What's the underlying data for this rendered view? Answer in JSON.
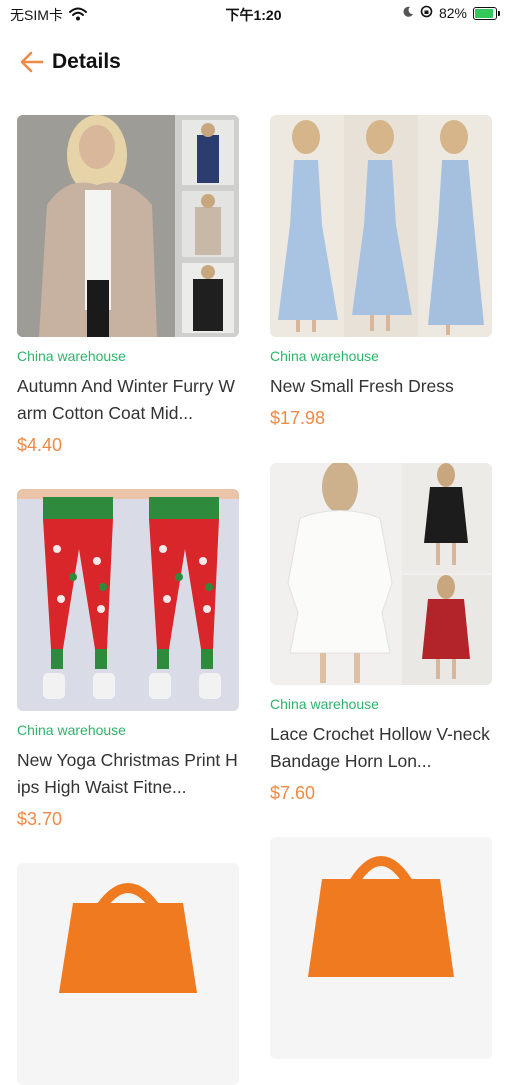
{
  "status_bar": {
    "carrier": "无SIM卡",
    "time": "下午1:20",
    "battery": "82%",
    "battery_level": 0.82
  },
  "header": {
    "title": "Details"
  },
  "products": [
    {
      "warehouse": "China warehouse",
      "title": "Autumn And Winter Furry Warm Cotton Coat Mid...",
      "price": "$4.40",
      "image": "furry-coat-photo"
    },
    {
      "warehouse": "China warehouse",
      "title": "New Small Fresh Dress",
      "price": "$17.98",
      "image": "blue-dress-photo"
    },
    {
      "warehouse": "China warehouse",
      "title": "New Yoga Christmas Print Hips High Waist Fitne...",
      "price": "$3.70",
      "image": "christmas-leggings-photo"
    },
    {
      "warehouse": "China warehouse",
      "title": "Lace Crochet Hollow V-neck Bandage Horn Lon...",
      "price": "$7.60",
      "image": "lace-dress-photo"
    },
    {
      "image": "shopping-bag-placeholder"
    },
    {
      "image": "shopping-bag-placeholder"
    }
  ],
  "colors": {
    "accent": "#ee8a46",
    "warehouse": "#2fb36b",
    "battery": "#34c759"
  }
}
